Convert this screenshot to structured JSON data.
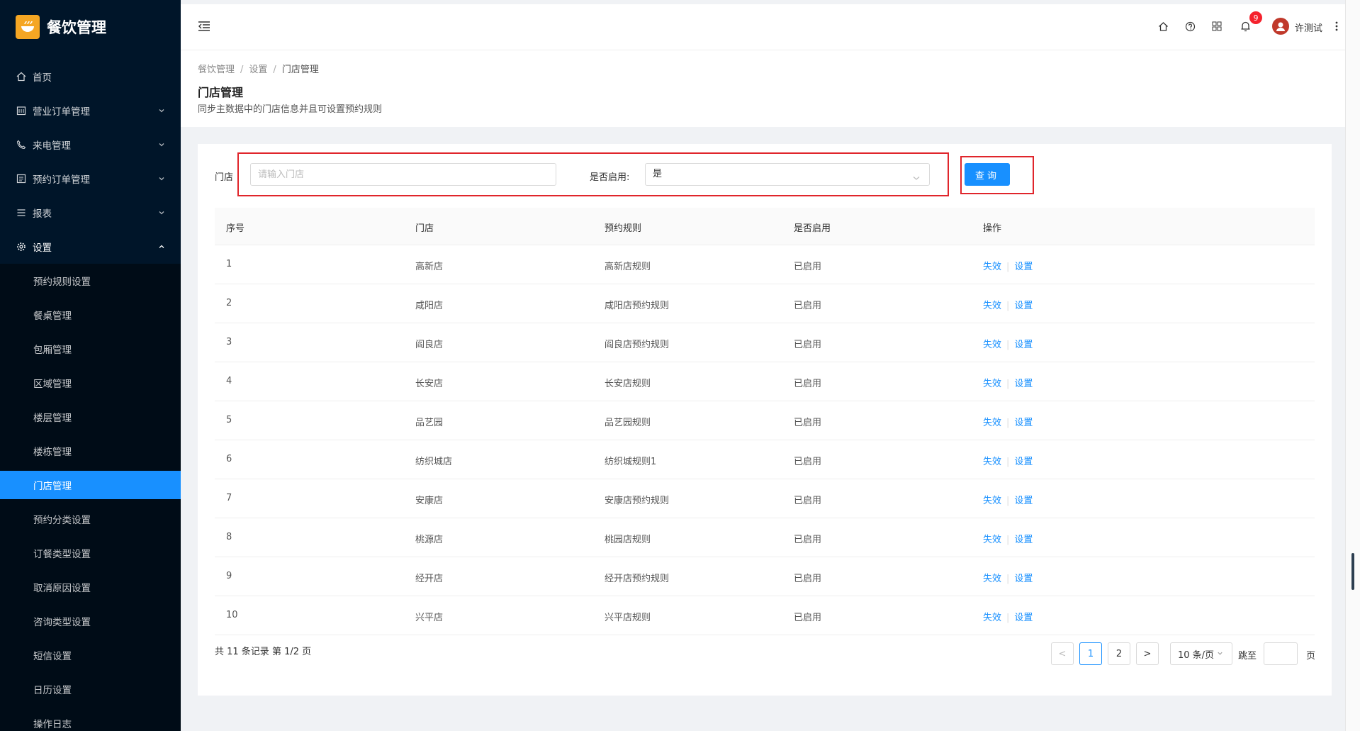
{
  "app": {
    "title": "餐饮管理"
  },
  "sidebar": {
    "top_items": [
      {
        "label": "首页"
      },
      {
        "label": "营业订单管理"
      },
      {
        "label": "来电管理"
      },
      {
        "label": "预约订单管理"
      },
      {
        "label": "报表"
      },
      {
        "label": "设置"
      }
    ],
    "sub_items": [
      {
        "label": "预约规则设置"
      },
      {
        "label": "餐桌管理"
      },
      {
        "label": "包厢管理"
      },
      {
        "label": "区域管理"
      },
      {
        "label": "楼层管理"
      },
      {
        "label": "楼栋管理"
      },
      {
        "label": "门店管理"
      },
      {
        "label": "预约分类设置"
      },
      {
        "label": "订餐类型设置"
      },
      {
        "label": "取消原因设置"
      },
      {
        "label": "咨询类型设置"
      },
      {
        "label": "短信设置"
      },
      {
        "label": "日历设置"
      },
      {
        "label": "操作日志"
      }
    ]
  },
  "header": {
    "notification_count": "9",
    "username": "许测试"
  },
  "breadcrumb": [
    "餐饮管理",
    "设置",
    "门店管理"
  ],
  "page": {
    "title": "门店管理",
    "subtitle": "同步主数据中的门店信息并且可设置预约规则"
  },
  "filter": {
    "store_label": "门店",
    "store_placeholder": "请输入门店",
    "enabled_label": "是否启用:",
    "enabled_value": "是",
    "query_button": "查询"
  },
  "table": {
    "headers": [
      "序号",
      "门店",
      "预约规则",
      "是否启用",
      "操作"
    ],
    "action_disable": "失效",
    "action_settings": "设置",
    "rows": [
      {
        "no": "1",
        "store": "高新店",
        "rule": "高新店规则",
        "enabled": "已启用"
      },
      {
        "no": "2",
        "store": "咸阳店",
        "rule": "咸阳店预约规则",
        "enabled": "已启用"
      },
      {
        "no": "3",
        "store": "阎良店",
        "rule": "阎良店预约规则",
        "enabled": "已启用"
      },
      {
        "no": "4",
        "store": "长安店",
        "rule": "长安店规则",
        "enabled": "已启用"
      },
      {
        "no": "5",
        "store": "品艺园",
        "rule": "品艺园规则",
        "enabled": "已启用"
      },
      {
        "no": "6",
        "store": "纺织城店",
        "rule": "纺织城规则1",
        "enabled": "已启用"
      },
      {
        "no": "7",
        "store": "安康店",
        "rule": "安康店预约规则",
        "enabled": "已启用"
      },
      {
        "no": "8",
        "store": "桃源店",
        "rule": "桃园店规则",
        "enabled": "已启用"
      },
      {
        "no": "9",
        "store": "经开店",
        "rule": "经开店预约规则",
        "enabled": "已启用"
      },
      {
        "no": "10",
        "store": "兴平店",
        "rule": "兴平店规则",
        "enabled": "已启用"
      }
    ]
  },
  "pagination": {
    "summary": "共 11 条记录 第 1/2 页",
    "prev": "<",
    "next": ">",
    "pages": [
      "1",
      "2"
    ],
    "page_size": "10 条/页",
    "jump_label": "跳至",
    "page_unit": "页"
  }
}
